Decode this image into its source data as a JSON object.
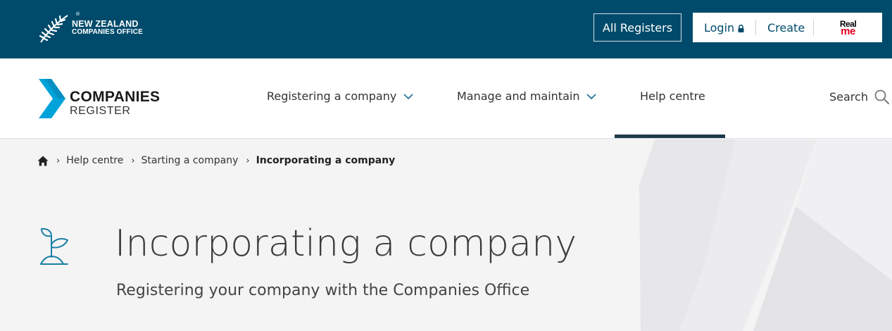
{
  "topbar": {
    "logo": {
      "line1": "NEW ZEALAND",
      "line2": "COMPANIES OFFICE",
      "icon": "silver-fern-icon",
      "reg": "®"
    },
    "all_registers": "All Registers",
    "login": "Login",
    "create": "Create",
    "realme": {
      "line1": "Real",
      "line2": "me"
    }
  },
  "navbar": {
    "logo": {
      "line1": "COMPANIES",
      "line2": "REGISTER",
      "icon": "chevron-logo-icon"
    },
    "items": [
      {
        "label": "Registering a company",
        "has_dropdown": true
      },
      {
        "label": "Manage and maintain",
        "has_dropdown": true
      },
      {
        "label": "Help centre",
        "active": true
      }
    ],
    "search_label": "Search"
  },
  "breadcrumb": {
    "home_icon": "home-icon",
    "items": [
      "Help centre",
      "Starting a company"
    ],
    "current": "Incorporating a company"
  },
  "page": {
    "icon": "sprout-icon",
    "title": "Incorporating a company",
    "subtitle": "Registering your company with the Companies Office"
  },
  "colors": {
    "topbar_bg": "#004b6b",
    "accent_teal": "#00a3d9",
    "active_bar": "#1f3a4a",
    "realme_red": "#e40020",
    "hero_bg": "#f4f4f5"
  }
}
